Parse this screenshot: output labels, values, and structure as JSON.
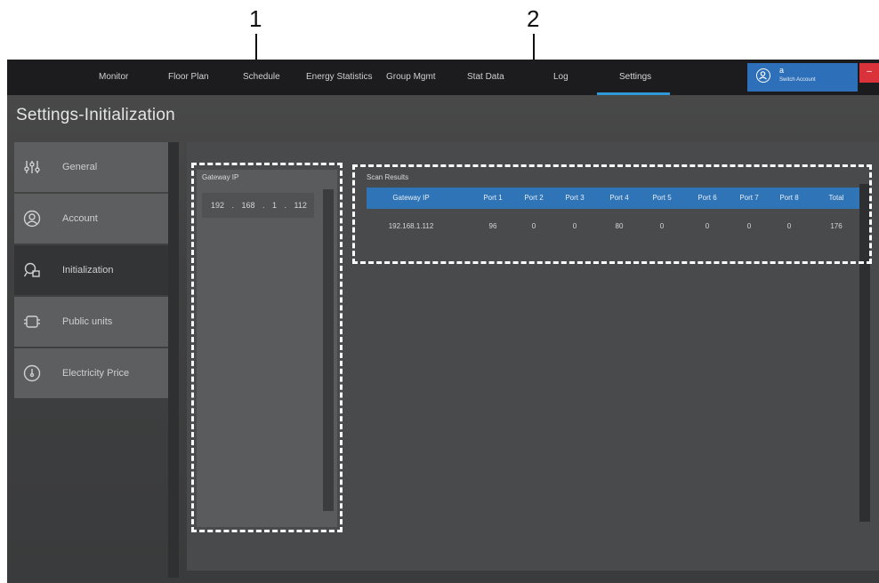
{
  "callouts": [
    "1",
    "2"
  ],
  "nav": {
    "items": [
      "Monitor",
      "Floor Plan",
      "Schedule",
      "Energy Statistics",
      "Group Mgmt",
      "Stat Data",
      "Log",
      "Settings"
    ],
    "active": "Settings",
    "accent_color": "#2f98d6"
  },
  "account": {
    "name": "a",
    "switch_label": "Switch Account",
    "close_label": "–",
    "icon": "user-circle-icon",
    "background_color": "#2d6fb8"
  },
  "page_title": "Settings-Initialization",
  "sidebar": {
    "items": [
      {
        "label": "General",
        "icon": "sliders-icon"
      },
      {
        "label": "Account",
        "icon": "user-circle-icon"
      },
      {
        "label": "Initialization",
        "icon": "search-device-icon"
      },
      {
        "label": "Public units",
        "icon": "device-unit-icon"
      },
      {
        "label": "Electricity Price",
        "icon": "meter-icon"
      }
    ],
    "active": "Initialization"
  },
  "gateway_panel": {
    "header": "Gateway IP",
    "row": "192 . 168 . 1 . 112"
  },
  "scan_results": {
    "title": "Scan Results",
    "columns": [
      "Gateway IP",
      "Port 1",
      "Port 2",
      "Port 3",
      "Port 4",
      "Port 5",
      "Port 6",
      "Port 7",
      "Port 8",
      "Total"
    ],
    "rows": [
      [
        "192.168.1.112",
        "96",
        "0",
        "0",
        "80",
        "0",
        "0",
        "0",
        "0",
        "176"
      ]
    ],
    "header_color": "#2e74b6"
  }
}
